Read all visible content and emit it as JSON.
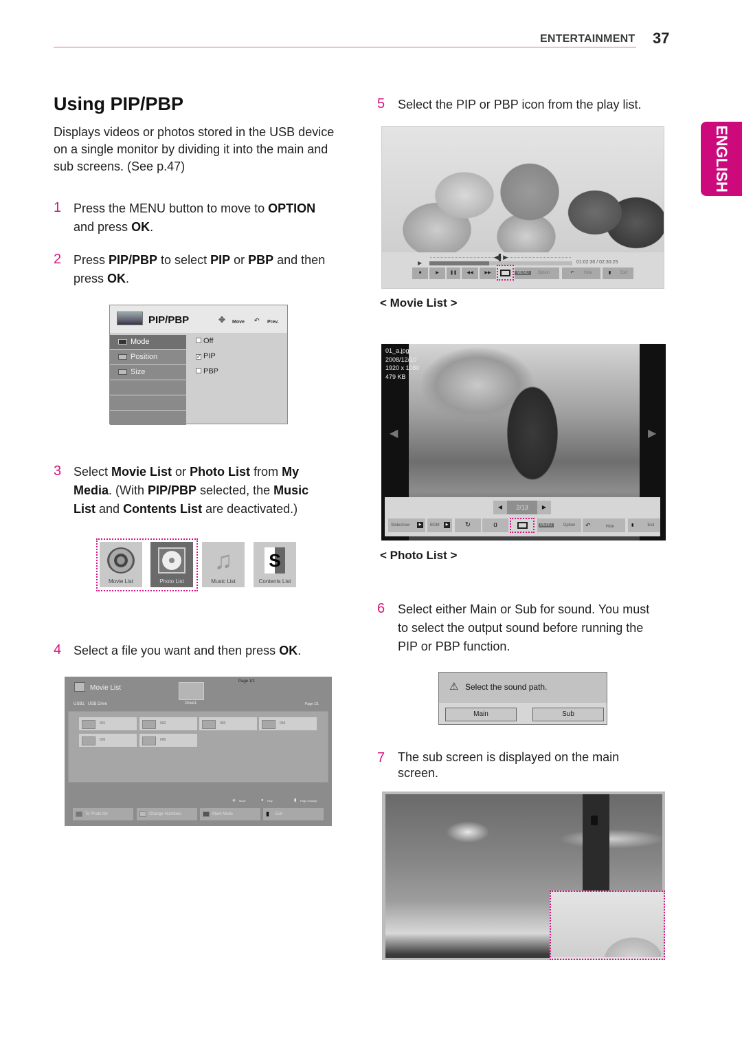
{
  "header": {
    "section": "ENTERTAINMENT",
    "page_number": "37",
    "language_tab": "ENGLISH"
  },
  "title": "Using PIP/PBP",
  "intro": [
    "Displays videos or photos stored in the USB device",
    "on a single monitor by dividing it into the main and",
    "sub screens. (See p.47)"
  ],
  "steps": {
    "s1": {
      "num": "1",
      "lines": [
        [
          "Press the MENU button to move to ",
          "OPTION"
        ],
        [
          "and press ",
          "OK",
          "."
        ]
      ]
    },
    "s2": {
      "num": "2"
    },
    "s3": {
      "num": "3"
    },
    "s4": {
      "num": "4",
      "text": "Select a file you want and then press ",
      "bold": "OK",
      "end": "."
    },
    "s5": {
      "num": "5",
      "text": "Select the PIP or PBP icon from the play list."
    },
    "s6": {
      "num": "6",
      "lines": [
        "Select either Main or Sub for sound. You must",
        "to select the output sound before running the",
        "PIP or PBP function."
      ]
    },
    "s7": {
      "num": "7",
      "lines": [
        "The sub screen is displayed on the main",
        "screen."
      ]
    }
  },
  "step_texts": {
    "s2_a": "Press ",
    "s2_b": "PIP/PBP",
    "s2_c": " to select ",
    "s2_d": "PIP",
    "s2_e": " or ",
    "s2_f": "PBP",
    "s2_g": " and then",
    "s2_h": "press ",
    "s2_i": "OK",
    "s2_j": ".",
    "s3_a": "Select ",
    "s3_b": "Movie List",
    "s3_c": " or ",
    "s3_d": "Photo List",
    "s3_e": " from ",
    "s3_f": "My",
    "s3_g": "Media",
    "s3_h": ". (With ",
    "s3_i": "PIP/PBP",
    "s3_j": " selected, the ",
    "s3_k": "Music",
    "s3_l": "List",
    "s3_m": " and ",
    "s3_n": "Contents List",
    "s3_o": " are deactivated.)"
  },
  "pip_menu": {
    "title": "PIP/PBP",
    "hint_move": "Move",
    "hint_prev": "Prev.",
    "items": [
      {
        "label": "Mode",
        "selected": true
      },
      {
        "label": "Position"
      },
      {
        "label": "Size"
      }
    ],
    "options": [
      {
        "label": "Off",
        "checked": false
      },
      {
        "label": "PIP",
        "checked": true
      },
      {
        "label": "PBP",
        "checked": false
      }
    ]
  },
  "my_media": {
    "tiles": [
      {
        "label": "Movie List",
        "icon": "film-reel-icon"
      },
      {
        "label": "Photo List",
        "icon": "flower-photo-icon",
        "active": true
      },
      {
        "label": "Music List",
        "icon": "music-note-icon"
      },
      {
        "label": "Contents List",
        "icon": "contents-s-icon"
      }
    ]
  },
  "movie_list_panel": {
    "title": "Movie List",
    "page": "Page 1/1",
    "path_usb": "USB1",
    "path_drive": "USB Drive",
    "folder_label": "Drive1",
    "page_small": "Page 1/1",
    "folders": [
      "001",
      "002",
      "003",
      "004",
      "005",
      "006"
    ],
    "hints": {
      "move": "Move",
      "play": "Play",
      "page_change": "Page Change"
    },
    "buttons": [
      "To Photo list",
      "Change Numbers",
      "Mark Mode",
      "Exit"
    ]
  },
  "movie_player": {
    "time_current": "01:02:30",
    "time_total": "02:30:25",
    "time_sep": " / ",
    "progress": 0.42,
    "controls": [
      "stop",
      "play",
      "pause",
      "rewind",
      "fast-forward",
      "pip"
    ],
    "menu_badge": "MENU",
    "option": "Option",
    "hide": "Hide",
    "exit": "Exit"
  },
  "movie_list_caption": "< Movie List >",
  "photo_viewer": {
    "file_info": [
      "01_a.jpg",
      "2008/12/10",
      "1920 x 1080",
      "479 KB"
    ],
    "page": "2/13",
    "buttons": {
      "slideshow": "Slideshow",
      "bgm": "BGM",
      "menu_badge": "MENU",
      "option": "Option",
      "hide": "Hide",
      "exit": "Exit"
    }
  },
  "photo_list_caption": "< Photo List >",
  "sound_dialog": {
    "message": "Select the sound path.",
    "main": "Main",
    "sub": "Sub"
  },
  "colors": {
    "accent": "#cc0a7c",
    "step_number": "#d4167f",
    "rule": "#e060a8"
  }
}
